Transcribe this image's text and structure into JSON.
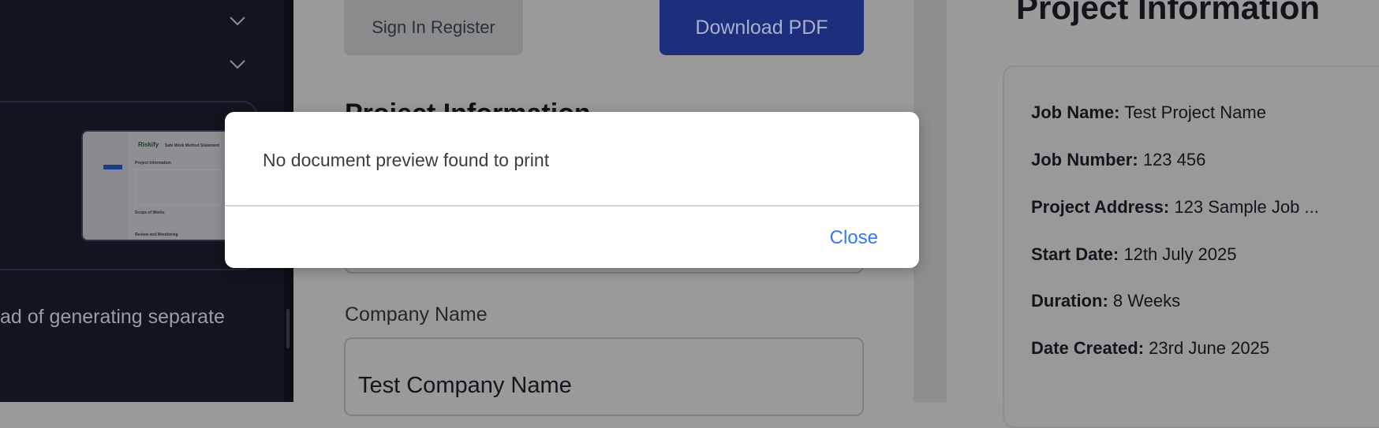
{
  "sidebar": {
    "description_fragment": "ad of generating separate",
    "thumbnail": {
      "logo": "Riskify",
      "doc_title": "Safe Work Method Statement",
      "section_1": "Project Information",
      "section_2": "Scope of Works",
      "section_3": "Review and Monitoring"
    }
  },
  "toolbar": {
    "signin_label": "Sign In Register",
    "download_label": "Download PDF"
  },
  "form": {
    "section_heading": "Project Information",
    "company_label": "Company Name",
    "company_value": "Test Company Name"
  },
  "preview": {
    "heading": "Project Information",
    "rows": [
      {
        "label": "Job Name:",
        "value": "Test Project Name"
      },
      {
        "label": "Job Number:",
        "value": "123 456"
      },
      {
        "label": "Project Address:",
        "value": "123 Sample Job ..."
      },
      {
        "label": "Start Date:",
        "value": "12th July 2025"
      },
      {
        "label": "Duration:",
        "value": "8 Weeks"
      },
      {
        "label": "Date Created:",
        "value": "23rd June 2025"
      }
    ]
  },
  "dialog": {
    "message": "No document preview found to print",
    "close_label": "Close"
  },
  "colors": {
    "accent": "#3478f6",
    "primary_button": "#1c2e7c",
    "sidebar": "#111520"
  }
}
